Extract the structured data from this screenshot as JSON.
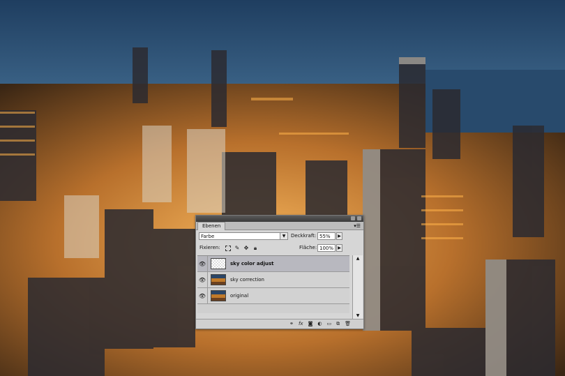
{
  "panel": {
    "tab_label": "Ebenen",
    "blend_mode": "Farbe",
    "opacity_label": "Deckkraft:",
    "opacity_value": "55%",
    "lock_label": "Fixieren:",
    "fill_label": "Fläche:",
    "fill_value": "100%",
    "layers": [
      {
        "name": "sky color adjust",
        "selected": true,
        "thumb": "transparent"
      },
      {
        "name": "sky correction",
        "selected": false,
        "thumb": "city"
      },
      {
        "name": "original",
        "selected": false,
        "thumb": "city"
      }
    ],
    "bottom_icons": [
      "link-icon",
      "fx-icon",
      "mask-icon",
      "adjustment-icon",
      "folder-icon",
      "new-layer-icon",
      "trash-icon"
    ]
  },
  "colors": {
    "sky": "#2f5a83",
    "city_glow": "#e89a3c",
    "selection": "#b8b8bf"
  }
}
